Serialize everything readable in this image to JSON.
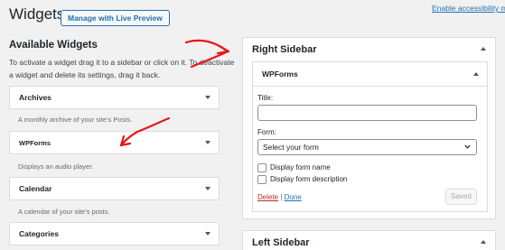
{
  "header": {
    "title": "Widgets",
    "manage_button": "Manage with Live Preview",
    "accessibility_link": "Enable accessibility m"
  },
  "available": {
    "heading": "Available Widgets",
    "description": "To activate a widget drag it to a sidebar or click on it. To deactivate a widget and delete its settings, drag it back.",
    "widgets": [
      {
        "title": "Archives",
        "description": "A monthly archive of your site’s Posts."
      },
      {
        "title": "WPForms",
        "description": "Displays an audio player."
      },
      {
        "title": "Calendar",
        "description": "A calendar of your site’s posts."
      },
      {
        "title": "Categories",
        "description": ""
      }
    ]
  },
  "right_sidebar": {
    "title": "Right Sidebar",
    "widget": {
      "title": "WPForms",
      "title_label": "Title:",
      "title_value": "",
      "form_label": "Form:",
      "form_selected": "Select your form",
      "checkbox_name": "Display form name",
      "checkbox_desc": "Display form description",
      "delete": "Delete",
      "separator": "|",
      "done": "Done",
      "saved": "Saved"
    }
  },
  "left_sidebar": {
    "title": "Left Sidebar"
  },
  "colors": {
    "accent": "#2271b1",
    "annotation_arrow": "#e8161b",
    "delete": "#b32d2e"
  }
}
